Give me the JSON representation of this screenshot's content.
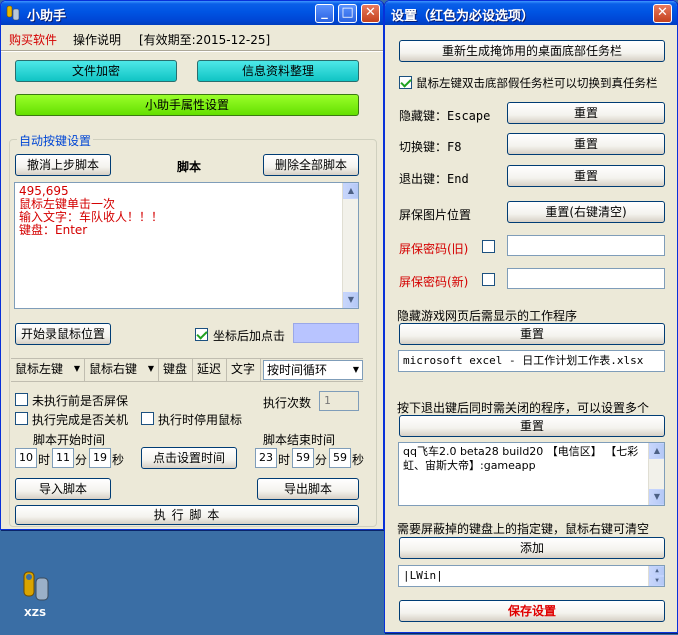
{
  "main_window": {
    "title": "小助手",
    "menu": {
      "buy": "购买软件",
      "help": "操作说明",
      "expiry": "[有效期至:2015-12-25]"
    },
    "buttons": {
      "encrypt": "文件加密",
      "info": "信息资料整理",
      "settings": "小助手属性设置"
    },
    "autokey": {
      "group_title": "自动按键设置",
      "undo": "撤消上步脚本",
      "script_label": "脚本",
      "delete_all": "删除全部脚本",
      "script_lines": [
        "495,695",
        "鼠标左键单击一次",
        "输入文字：车队收人！！！",
        "键盘：Enter"
      ],
      "record_mouse": "开始录鼠标位置",
      "coord_click_label": "坐标后加点击",
      "toolbar": {
        "left_click": "鼠标左键",
        "right_click": "鼠标右键",
        "keyboard": "键盘",
        "delay": "延迟",
        "text": "文字",
        "loop_mode": "按时间循环"
      },
      "screen_save_label": "未执行前是否屏保",
      "exec_count_label": "执行次数",
      "exec_count_value": "1",
      "shutdown_label": "执行完成是否关机",
      "stop_mouse_label": "执行时停用鼠标",
      "start_time_label": "脚本开始时间",
      "end_time_label": "脚本结束时间",
      "start_time": {
        "h": "10",
        "m": "11",
        "s": "19"
      },
      "end_time": {
        "h": "23",
        "m": "59",
        "s": "59"
      },
      "unit_h": "时",
      "unit_m": "分",
      "unit_s": "秒",
      "set_time": "点击设置时间",
      "import": "导入脚本",
      "export": "导出脚本",
      "execute": "执 行 脚 本"
    }
  },
  "settings_window": {
    "title": "设置（红色为必设选项）",
    "regen_taskbar": "重新生成掩饰用的桌面底部任务栏",
    "dblclick_taskbar_label": "鼠标左键双击底部假任务栏可以切换到真任务栏",
    "hide_key_label": "隐藏键：Escape",
    "switch_key_label": "切换键：F8",
    "exit_key_label": "退出键：End",
    "reset": "重置",
    "screensaver_pos_label": "屏保图片位置",
    "reset_rightclick": "重置(右键清空)",
    "pwd_old_label": "屏保密码(旧)",
    "pwd_new_label": "屏保密码(新)",
    "hidden_program_label": "隐藏游戏网页后需显示的工作程序",
    "hidden_program_value": "microsoft excel - 日工作计划工作表.xlsx",
    "close_programs_label": "按下退出键后同时需关闭的程序，可以设置多个",
    "close_programs_value": "qq飞车2.0 beta28 build20 【电信区】 【七彩虹、宙斯大帝】:gameapp",
    "block_keys_label": "需要屏蔽掉的键盘上的指定键，鼠标右键可清空",
    "add": "添加",
    "block_keys_value": "|LWin|",
    "save": "保存设置"
  },
  "desktop": {
    "icon_label": "XZS"
  },
  "colors": {
    "title_blue": "#0054e3",
    "required_red": "#d40000",
    "accent_cyan": "#10c4c4",
    "accent_green": "#64e000"
  }
}
